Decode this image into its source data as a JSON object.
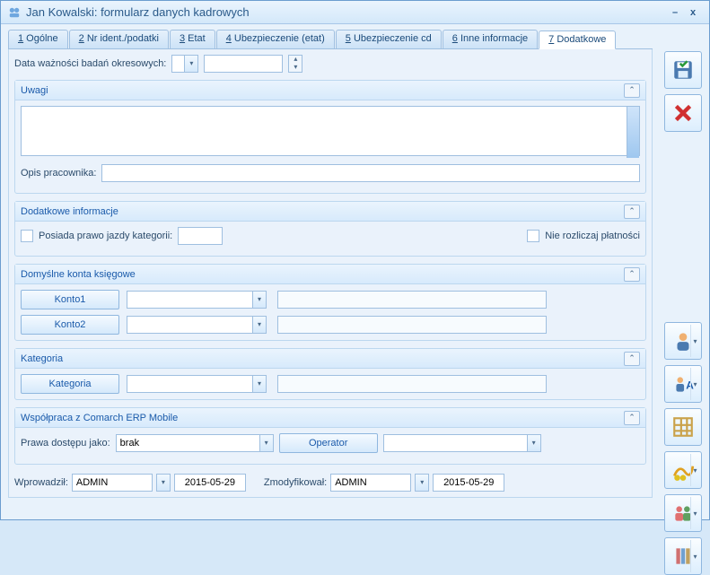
{
  "window": {
    "title": "Jan Kowalski: formularz danych kadrowych"
  },
  "tabs": [
    {
      "u": "1",
      "label": " Ogólne"
    },
    {
      "u": "2",
      "label": " Nr ident./podatki"
    },
    {
      "u": "3",
      "label": " Etat"
    },
    {
      "u": "4",
      "label": " Ubezpieczenie (etat)"
    },
    {
      "u": "5",
      "label": " Ubezpieczenie cd"
    },
    {
      "u": "6",
      "label": " Inne informacje"
    },
    {
      "u": "7",
      "label": " Dodatkowe"
    }
  ],
  "activeTab": 6,
  "top": {
    "label": "Data ważności badań okresowych:",
    "value": ""
  },
  "uwagi": {
    "title": "Uwagi",
    "text": "",
    "opisLabel": "Opis pracownika:",
    "opis": ""
  },
  "dodatkowe": {
    "title": "Dodatkowe informacje",
    "posLabel": "Posiada prawo jazdy kategorii:",
    "posVal": "",
    "nierozLabel": "Nie rozliczaj płatności"
  },
  "konta": {
    "title": "Domyślne konta księgowe",
    "k1": "Konto1",
    "k2": "Konto2"
  },
  "kategoria": {
    "title": "Kategoria",
    "btn": "Kategoria"
  },
  "mobile": {
    "title": "Współpraca z Comarch ERP Mobile",
    "prawaLabel": "Prawa dostępu jako:",
    "prawaVal": "brak",
    "opBtn": "Operator"
  },
  "footer": {
    "wprLabel": "Wprowadził:",
    "wprVal": "ADMIN",
    "wprDate": "2015-05-29",
    "zmLabel": "Zmodyfikował:",
    "zmVal": "ADMIN",
    "zmDate": "2015-05-29"
  }
}
